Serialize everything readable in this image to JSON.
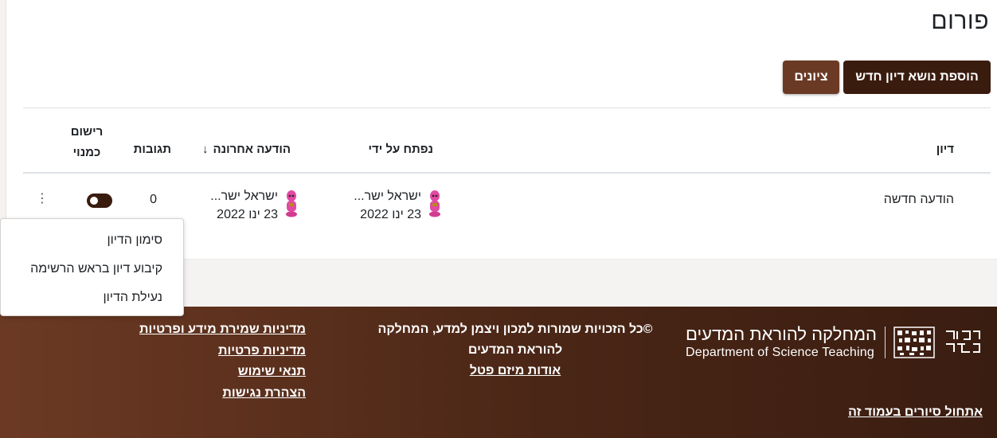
{
  "page": {
    "title": "פורום"
  },
  "actions": {
    "add_topic": "הוספת נושא דיון חדש",
    "grades": "ציונים"
  },
  "table": {
    "headers": {
      "discussion": "דיון",
      "started_by": "נפתח על ידי",
      "last_post": "הודעה אחרונה",
      "replies": "תגובות",
      "subscribe_line1": "רישום",
      "subscribe_line2": "כמנוי"
    },
    "sort_icon": "↓",
    "rows": [
      {
        "topic": "הודעה חדשה",
        "started_by_name": "ישראל ישר...",
        "started_by_date": "23 ינו 2022",
        "last_post_name": "ישראל ישר...",
        "last_post_date": "23 ינו 2022",
        "replies": "0",
        "subscribed": true,
        "kebab_icon": "⋮"
      }
    ]
  },
  "context_menu": {
    "items": [
      "סימון הדיון",
      "קיבוע דיון בראש הרשימה",
      "נעילת הדיון"
    ]
  },
  "footer": {
    "logo_he": "המחלקה להוראת המדעים",
    "logo_en": "Department of Science Teaching",
    "copyright_line1": "©כל הזכויות שמורות למכון ויצמן למדע, המחלקה",
    "copyright_line2": "להוראת המדעים",
    "about_link": "אודות מיזם פטל",
    "links": [
      "מדיניות שמירת מידע ופרטיות",
      "מדיניות פרטיות",
      "תנאי שימוש",
      "הצהרת נגישות"
    ],
    "monitor_link": "אתחול סיורים בעמוד זה"
  },
  "colors": {
    "primary": "#3a1c0f",
    "secondary": "#6b3a25"
  }
}
